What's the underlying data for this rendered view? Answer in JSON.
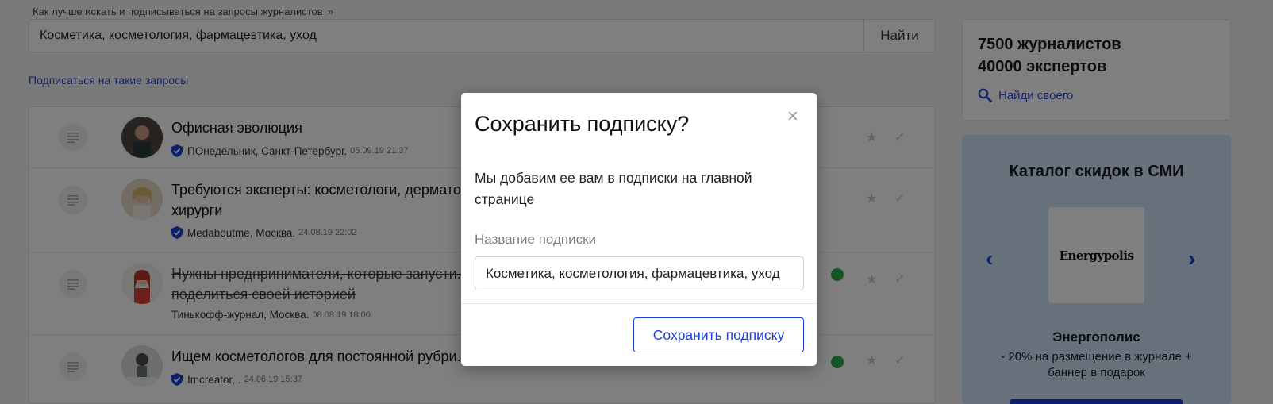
{
  "hint": {
    "text": "Как лучше искать и подписываться на запросы журналистов",
    "arrow": "»"
  },
  "search": {
    "query": "Косметика, косметология, фармацевтика, уход",
    "button": "Найти"
  },
  "subscribe_link": "Подписаться на такие запросы",
  "rows": [
    {
      "title": "Офисная эволюция",
      "source": "ПОнедельник, Санкт-Петербург.",
      "date": "05.09.19 21:37",
      "verified": true
    },
    {
      "title": "Требуются эксперты: косметологи, дермато...",
      "title2": "хирурги",
      "source": "Medaboutme, Москва.",
      "date": "24.08.19 22:02",
      "verified": true
    },
    {
      "title": "Нужны предприниматели, которые запусти...",
      "title2": "поделиться своей историей",
      "source": "Тинькофф-журнал, Москва.",
      "date": "08.08.19 18:00",
      "verified": false
    },
    {
      "title": "Ищем косметологов для постоянной рубри...",
      "source": "Imcreator, .",
      "date": "24.06.19 15:37",
      "verified": true
    }
  ],
  "stats": {
    "line1": "7500 журналистов",
    "line2": "40000 экспертов",
    "find": "Найди своего"
  },
  "promo": {
    "heading": "Каталог скидок в СМИ",
    "logo": "Energypolis",
    "name": "Энергополис",
    "desc": "- 20% на размещение в журнале + баннер в подарок"
  },
  "modal": {
    "title": "Сохранить подписку?",
    "close": "×",
    "desc": "Мы добавим ее вам в подписки на главной странице",
    "label": "Название подписки",
    "input_value": "Косметика, косметология, фармацевтика, уход",
    "save": "Сохранить подписку"
  },
  "colors": {
    "accent": "#1b3fd6",
    "link": "#2a4bd7",
    "promo_bg": "#cfe3f8",
    "overlay": "rgba(0,0,0,0.5)"
  }
}
